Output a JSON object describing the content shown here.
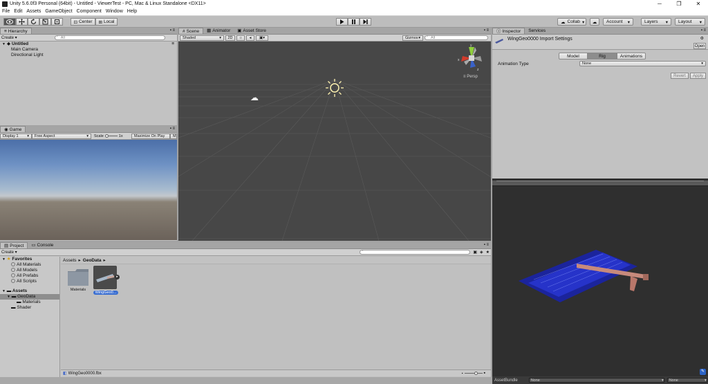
{
  "window": {
    "title": "Unity 5.6.0f3 Personal (64bit) - Untitled - ViewerTest - PC, Mac & Linux Standalone <DX11>",
    "controls": [
      "─",
      "❐",
      "✕"
    ]
  },
  "menu": [
    "File",
    "Edit",
    "Assets",
    "GameObject",
    "Component",
    "Window",
    "Help"
  ],
  "toolbar": {
    "pivot": "Center",
    "space": "Local",
    "collab": "Collab",
    "account": "Account",
    "layers": "Layers",
    "layout": "Layout"
  },
  "hierarchy": {
    "tab": "Hierarchy",
    "create": "Create",
    "search": "All",
    "scene": "Untitled",
    "items": [
      "Main Camera",
      "Directional Light"
    ]
  },
  "scene": {
    "tabs": [
      "Scene",
      "Animator",
      "Asset Store"
    ],
    "shading": "Shaded",
    "mode2d": "2D",
    "gizmos": "Gizmos",
    "search": "All",
    "persp": "Persp",
    "axes": {
      "y": "y",
      "x": "x",
      "z": "z"
    }
  },
  "game": {
    "tab": "Game",
    "display": "Display 1",
    "aspect": "Free Aspect",
    "scale_label": "Scale",
    "scale_value": "1x",
    "maximize": "Maximize On Play",
    "more": "Mu"
  },
  "project": {
    "tabs": [
      "Project",
      "Console"
    ],
    "create": "Create",
    "favorites": "Favorites",
    "fav_items": [
      "All Materials",
      "All Models",
      "All Prefabs",
      "All Scripts"
    ],
    "assets": "Assets",
    "folders": [
      "GeoData",
      "Materials",
      "Shader"
    ],
    "breadcrumb": [
      "Assets",
      "GeoData"
    ],
    "tiles": [
      "Materials",
      "WingGeo0..."
    ],
    "status_file": "WingGeo0000.fbx"
  },
  "inspector": {
    "tabs": [
      "Inspector",
      "Services"
    ],
    "title": "WingGeo0000 Import Settings",
    "open": "Open",
    "segments": [
      "Model",
      "Rig",
      "Animations"
    ],
    "active_segment": "Rig",
    "field_label": "Animation Type",
    "field_value": "None",
    "revert": "Revert",
    "apply": "Apply"
  },
  "preview": {
    "asset_bundle_label": "AssetBundle",
    "bundle_value": "None",
    "variant_value": "None"
  }
}
